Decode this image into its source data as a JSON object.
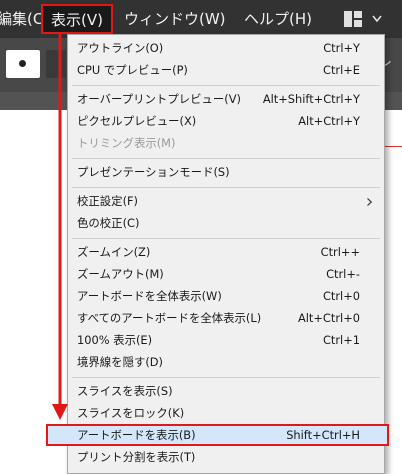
{
  "menubar": {
    "file_label": "編集(C)",
    "view_label": "表示(V)",
    "window_label": "ウィンドウ(W)",
    "help_label": "ヘルプ(H)",
    "workspace_icon": "workspace-layout-icon"
  },
  "controlbar": {
    "peek_text": "レ"
  },
  "view_menu": {
    "items": [
      {
        "label": "アウトライン(O)",
        "shortcut": "Ctrl+Y"
      },
      {
        "label": "CPU でプレビュー(P)",
        "shortcut": "Ctrl+E"
      },
      {
        "label": "オーバープリントプレビュー(V)",
        "shortcut": "Alt+Shift+Ctrl+Y"
      },
      {
        "label": "ピクセルプレビュー(X)",
        "shortcut": "Alt+Ctrl+Y"
      },
      {
        "label": "トリミング表示(M)",
        "shortcut": ""
      },
      {
        "label": "プレゼンテーションモード(S)",
        "shortcut": ""
      },
      {
        "label": "校正設定(F)",
        "shortcut": "",
        "submenu_icon": "chevron-right-icon"
      },
      {
        "label": "色の校正(C)",
        "shortcut": ""
      },
      {
        "label": "ズームイン(Z)",
        "shortcut": "Ctrl++"
      },
      {
        "label": "ズームアウト(M)",
        "shortcut": "Ctrl+-"
      },
      {
        "label": "アートボードを全体表示(W)",
        "shortcut": "Ctrl+0"
      },
      {
        "label": "すべてのアートボードを全体表示(L)",
        "shortcut": "Alt+Ctrl+0"
      },
      {
        "label": "100% 表示(E)",
        "shortcut": "Ctrl+1"
      },
      {
        "label": "境界線を隠す(D)",
        "shortcut": ""
      },
      {
        "label": "スライスを表示(S)",
        "shortcut": ""
      },
      {
        "label": "スライスをロック(K)",
        "shortcut": ""
      },
      {
        "label": "アートボードを表示(B)",
        "shortcut": "Shift+Ctrl+H"
      },
      {
        "label": "プリント分割を表示(T)",
        "shortcut": ""
      }
    ]
  },
  "colors": {
    "annotation": "#e01818",
    "highlight_fill": "#d3e6fa"
  }
}
